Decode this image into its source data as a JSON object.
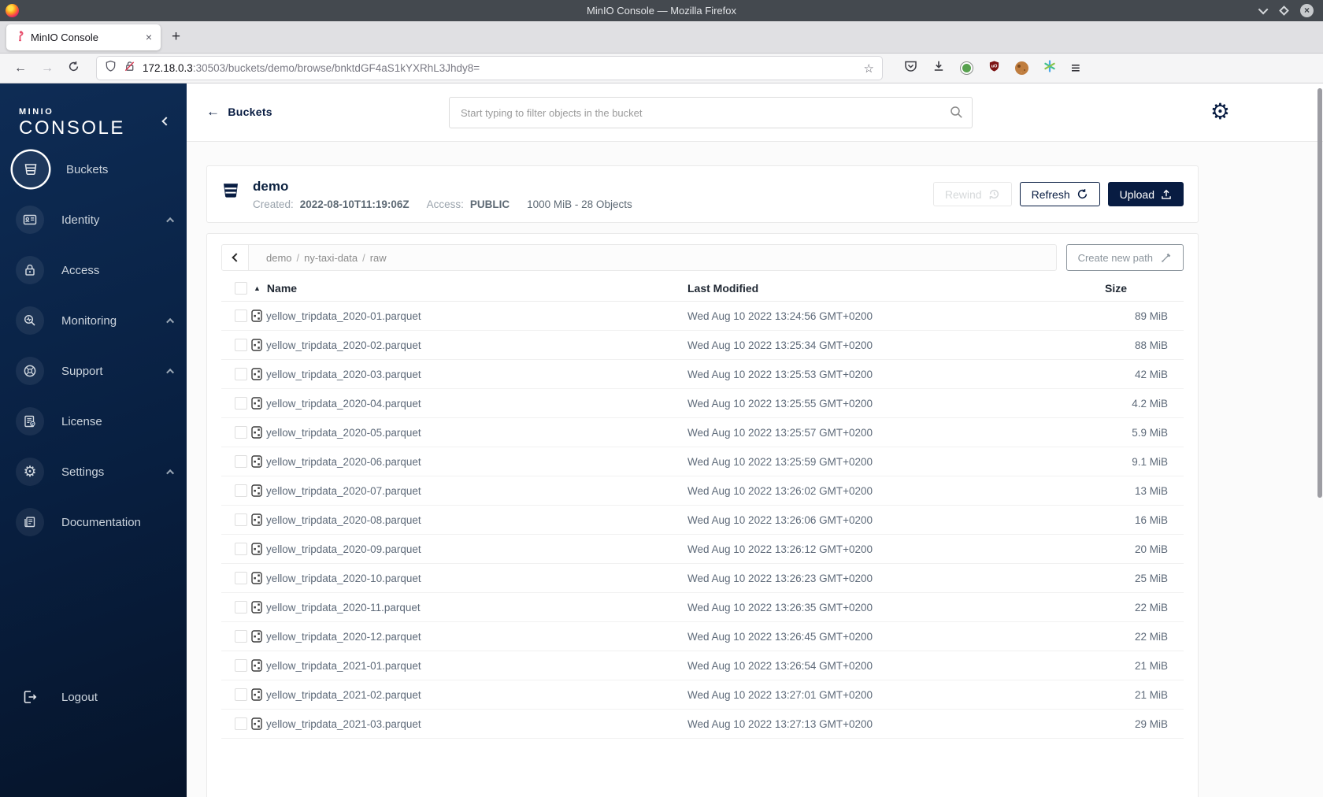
{
  "window": {
    "title": "MinIO Console — Mozilla Firefox"
  },
  "browser": {
    "tab_title": "MinIO Console",
    "new_tab_label": "+",
    "close_tab_label": "×",
    "url_host": "172.18.0.3",
    "url_rest": ":30503/buckets/demo/browse/bnktdGF4aS1kYXRhL3Jhdy8=",
    "toolbar_icons": [
      "shield-icon",
      "broken-lock-icon",
      "bookmark-star-icon",
      "pocket-icon",
      "download-icon",
      "privacy-badger-icon",
      "ublock-icon",
      "cookie-icon",
      "multi-account-icon",
      "menu-icon"
    ]
  },
  "sidebar": {
    "logo_top": "MINIO",
    "logo_bottom": "CONSOLE",
    "items": [
      {
        "label": "Buckets",
        "icon": "buckets-icon",
        "active": true,
        "expandable": false
      },
      {
        "label": "Identity",
        "icon": "identity-icon",
        "active": false,
        "expandable": true
      },
      {
        "label": "Access",
        "icon": "access-icon",
        "active": false,
        "expandable": false
      },
      {
        "label": "Monitoring",
        "icon": "monitoring-icon",
        "active": false,
        "expandable": true
      },
      {
        "label": "Support",
        "icon": "support-icon",
        "active": false,
        "expandable": true
      },
      {
        "label": "License",
        "icon": "license-icon",
        "active": false,
        "expandable": false
      },
      {
        "label": "Settings",
        "icon": "settings-icon",
        "active": false,
        "expandable": true
      },
      {
        "label": "Documentation",
        "icon": "documentation-icon",
        "active": false,
        "expandable": false
      }
    ],
    "logout_label": "Logout"
  },
  "topbar": {
    "back_label": "Buckets",
    "search_placeholder": "Start typing to filter objects in the bucket"
  },
  "bucket": {
    "name": "demo",
    "created_label": "Created:",
    "created_value": "2022-08-10T11:19:06Z",
    "access_label": "Access:",
    "access_value": "PUBLIC",
    "summary": "1000 MiB - 28 Objects",
    "rewind_label": "Rewind",
    "refresh_label": "Refresh",
    "upload_label": "Upload"
  },
  "path_bar": {
    "breadcrumb": [
      "demo",
      "ny-taxi-data",
      "raw"
    ],
    "separator": "/",
    "create_path_label": "Create new path"
  },
  "table": {
    "columns": [
      "Name",
      "Last Modified",
      "Size"
    ],
    "rows": [
      {
        "name": "yellow_tripdata_2020-01.parquet",
        "modified": "Wed Aug 10 2022 13:24:56 GMT+0200",
        "size": "89 MiB"
      },
      {
        "name": "yellow_tripdata_2020-02.parquet",
        "modified": "Wed Aug 10 2022 13:25:34 GMT+0200",
        "size": "88 MiB"
      },
      {
        "name": "yellow_tripdata_2020-03.parquet",
        "modified": "Wed Aug 10 2022 13:25:53 GMT+0200",
        "size": "42 MiB"
      },
      {
        "name": "yellow_tripdata_2020-04.parquet",
        "modified": "Wed Aug 10 2022 13:25:55 GMT+0200",
        "size": "4.2 MiB"
      },
      {
        "name": "yellow_tripdata_2020-05.parquet",
        "modified": "Wed Aug 10 2022 13:25:57 GMT+0200",
        "size": "5.9 MiB"
      },
      {
        "name": "yellow_tripdata_2020-06.parquet",
        "modified": "Wed Aug 10 2022 13:25:59 GMT+0200",
        "size": "9.1 MiB"
      },
      {
        "name": "yellow_tripdata_2020-07.parquet",
        "modified": "Wed Aug 10 2022 13:26:02 GMT+0200",
        "size": "13 MiB"
      },
      {
        "name": "yellow_tripdata_2020-08.parquet",
        "modified": "Wed Aug 10 2022 13:26:06 GMT+0200",
        "size": "16 MiB"
      },
      {
        "name": "yellow_tripdata_2020-09.parquet",
        "modified": "Wed Aug 10 2022 13:26:12 GMT+0200",
        "size": "20 MiB"
      },
      {
        "name": "yellow_tripdata_2020-10.parquet",
        "modified": "Wed Aug 10 2022 13:26:23 GMT+0200",
        "size": "25 MiB"
      },
      {
        "name": "yellow_tripdata_2020-11.parquet",
        "modified": "Wed Aug 10 2022 13:26:35 GMT+0200",
        "size": "22 MiB"
      },
      {
        "name": "yellow_tripdata_2020-12.parquet",
        "modified": "Wed Aug 10 2022 13:26:45 GMT+0200",
        "size": "22 MiB"
      },
      {
        "name": "yellow_tripdata_2021-01.parquet",
        "modified": "Wed Aug 10 2022 13:26:54 GMT+0200",
        "size": "21 MiB"
      },
      {
        "name": "yellow_tripdata_2021-02.parquet",
        "modified": "Wed Aug 10 2022 13:27:01 GMT+0200",
        "size": "21 MiB"
      },
      {
        "name": "yellow_tripdata_2021-03.parquet",
        "modified": "Wed Aug 10 2022 13:27:13 GMT+0200",
        "size": "29 MiB"
      }
    ]
  },
  "colors": {
    "accent_navy": "#081C42",
    "sidebar_gradient_top": "#0E2C55",
    "sidebar_gradient_bottom": "#06142A",
    "titlebar": "#44494F",
    "disabled_button_text": "#D5D8DA",
    "row_text": "#5E6A79",
    "placeholder_text": "#9B9B9B"
  }
}
